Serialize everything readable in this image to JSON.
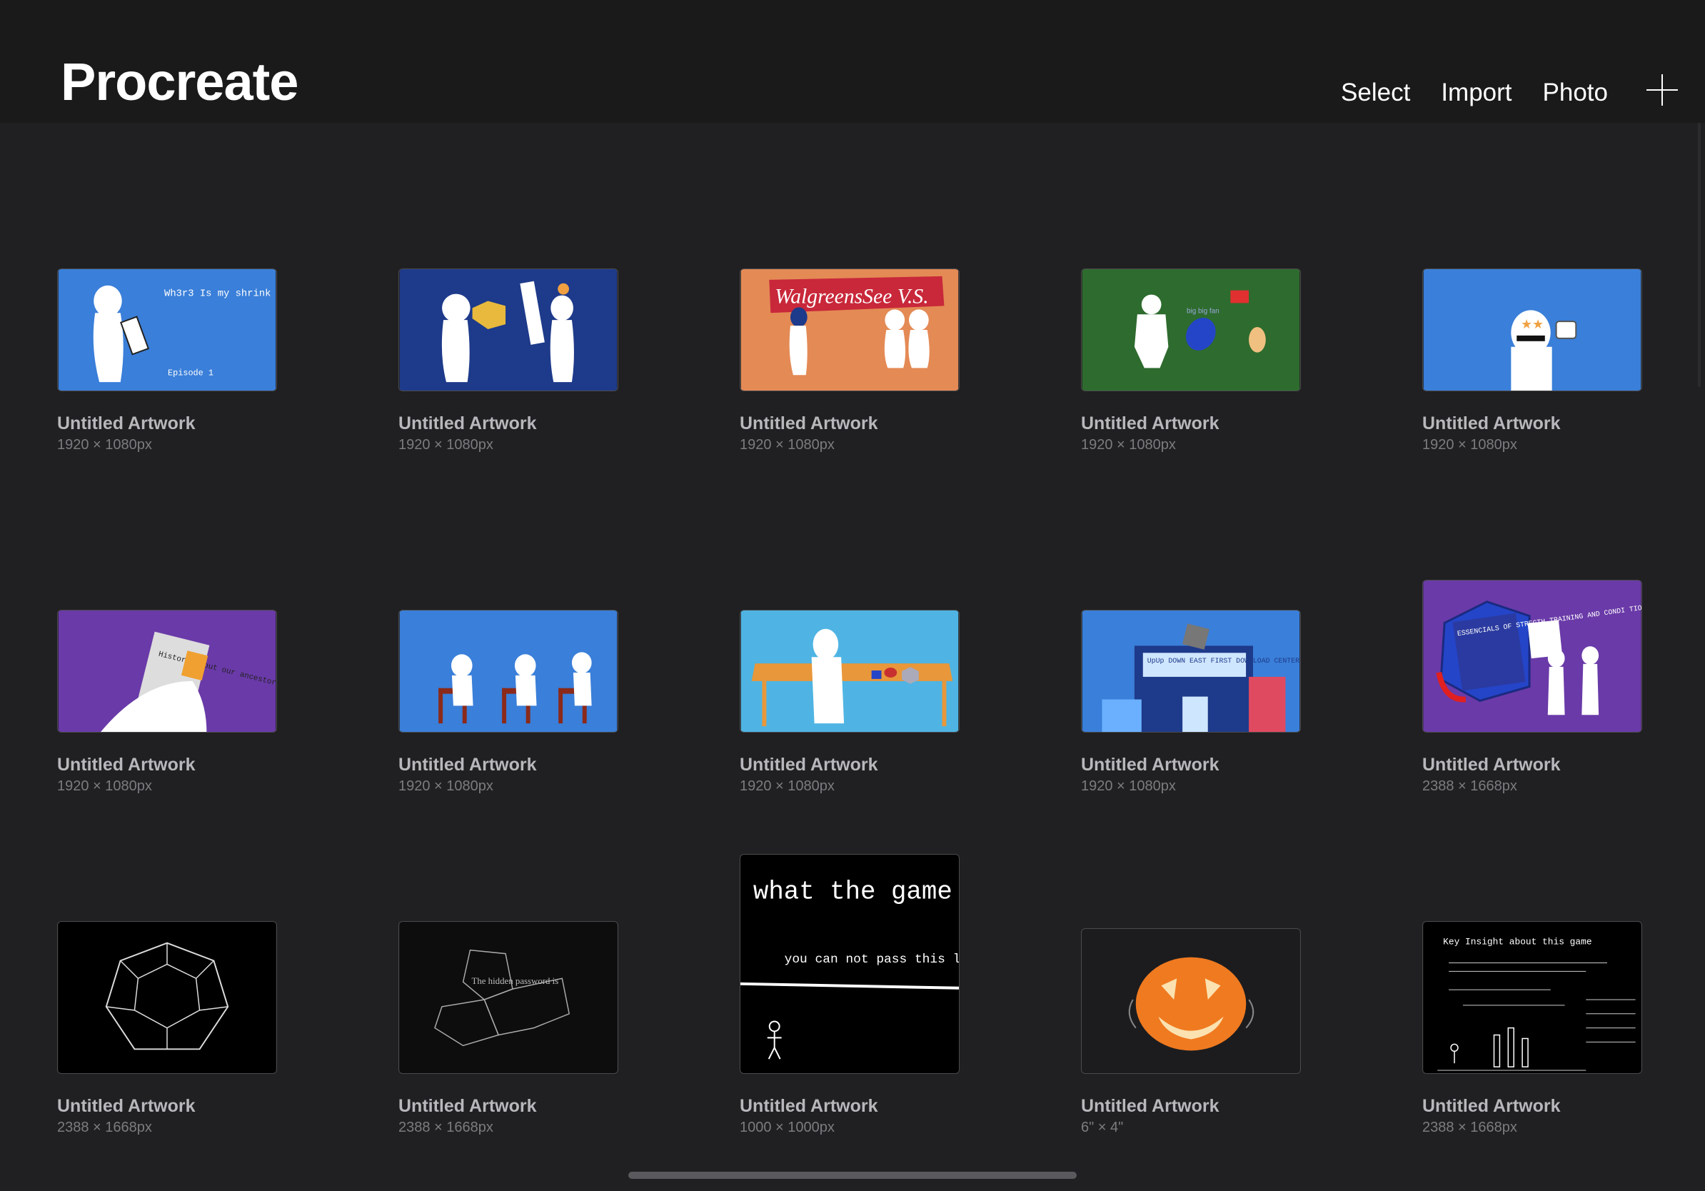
{
  "header": {
    "title": "Procreate",
    "actions": {
      "select": "Select",
      "import": "Import",
      "photo": "Photo"
    },
    "add_icon": "plus-icon"
  },
  "artworks": [
    {
      "title": "Untitled Artwork",
      "size": "1920 × 1080px",
      "thumb_bg": "#3a7fd9",
      "thumb_text": "Wh3r3 Is my shrink ? Episode 1"
    },
    {
      "title": "Untitled Artwork",
      "size": "1920 × 1080px",
      "thumb_bg": "#1e3a8a"
    },
    {
      "title": "Untitled Artwork",
      "size": "1920 × 1080px",
      "thumb_bg": "#e48a55",
      "thumb_text": "WalgreensSee V.S."
    },
    {
      "title": "Untitled Artwork",
      "size": "1920 × 1080px",
      "thumb_bg": "#2e6b2e",
      "thumb_text": "big big fan"
    },
    {
      "title": "Untitled Artwork",
      "size": "1920 × 1080px",
      "thumb_bg": "#3a7fd9"
    },
    {
      "title": "Untitled Artwork",
      "size": "1920 × 1080px",
      "thumb_bg": "#6a3aa8",
      "thumb_text": "History about our ancestors"
    },
    {
      "title": "Untitled Artwork",
      "size": "1920 × 1080px",
      "thumb_bg": "#3a7fd9"
    },
    {
      "title": "Untitled Artwork",
      "size": "1920 × 1080px",
      "thumb_bg": "#4fb4e3"
    },
    {
      "title": "Untitled Artwork",
      "size": "1920 × 1080px",
      "thumb_bg": "#3a7fd9",
      "thumb_text": "UpUp DOWN EAST FIRST DOWNLOAD CENTER"
    },
    {
      "title": "Untitled Artwork",
      "size": "2388 × 1668px",
      "thumb_bg": "#6a3aa8",
      "thumb_text": "ESSENCIALS OF STREGTH TRAINING AND CONDI TIONING"
    },
    {
      "title": "Untitled Artwork",
      "size": "2388 × 1668px",
      "thumb_bg": "#000000"
    },
    {
      "title": "Untitled Artwork",
      "size": "2388 × 1668px",
      "thumb_bg": "#0d0d0d",
      "thumb_text": "The hidden password is"
    },
    {
      "title": "Untitled Artwork",
      "size": "1000 × 1000px",
      "thumb_bg": "#000000",
      "thumb_text": "what the game",
      "thumb_text2": "you can not pass this line"
    },
    {
      "title": "Untitled Artwork",
      "size": "6\" × 4\"",
      "thumb_bg": "#1c1c1e"
    },
    {
      "title": "Untitled Artwork",
      "size": "2388 × 1668px",
      "thumb_bg": "#000000",
      "thumb_text": "Key Insight about this game"
    }
  ],
  "colors": {
    "background": "#202022",
    "header": "#1a1a1b",
    "title_text": "#b8b8bc",
    "size_text": "#7c7c80"
  }
}
